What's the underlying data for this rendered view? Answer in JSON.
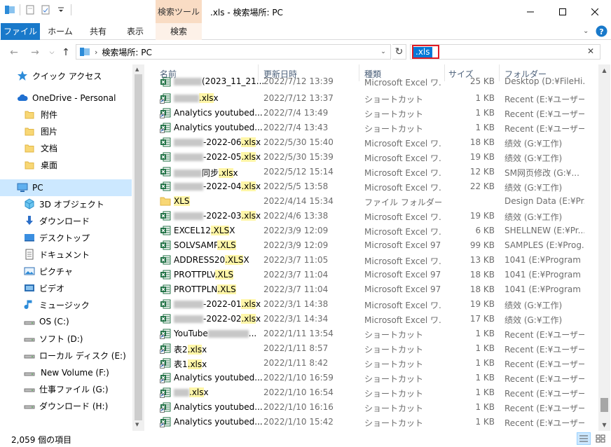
{
  "window": {
    "title": ".xls - 検索場所: PC",
    "context_tab_head": "検索ツール",
    "controls": [
      "minimize",
      "maximize",
      "close"
    ]
  },
  "ribbon": {
    "tabs": [
      "ファイル",
      "ホーム",
      "共有",
      "表示",
      "検索"
    ]
  },
  "address": {
    "crumb": "検索場所: PC"
  },
  "search": {
    "value": ".xls"
  },
  "nav": {
    "items": [
      {
        "label": "クイック アクセス",
        "icon": "star-icon"
      },
      {
        "label": "OneDrive - Personal",
        "icon": "cloud-icon"
      },
      {
        "label": "附件",
        "icon": "folder-icon"
      },
      {
        "label": "图片",
        "icon": "folder-icon"
      },
      {
        "label": "文档",
        "icon": "folder-icon"
      },
      {
        "label": "桌面",
        "icon": "folder-icon"
      },
      {
        "label": "PC",
        "icon": "pc-icon",
        "selected": true
      },
      {
        "label": "3D オブジェクト",
        "icon": "cube-icon"
      },
      {
        "label": "ダウンロード",
        "icon": "download-icon"
      },
      {
        "label": "デスクトップ",
        "icon": "desktop-icon"
      },
      {
        "label": "ドキュメント",
        "icon": "document-icon"
      },
      {
        "label": "ピクチャ",
        "icon": "picture-icon"
      },
      {
        "label": "ビデオ",
        "icon": "video-icon"
      },
      {
        "label": "ミュージック",
        "icon": "music-icon"
      },
      {
        "label": "OS (C:)",
        "icon": "drive-icon"
      },
      {
        "label": "ソフト (D:)",
        "icon": "drive-icon"
      },
      {
        "label": "ローカル ディスク (E:)",
        "icon": "drive-icon"
      },
      {
        "label": "New Volume (F:)",
        "icon": "drive-icon"
      },
      {
        "label": "仕事ファイル (G:)",
        "icon": "drive-icon"
      },
      {
        "label": "ダウンロード (H:)",
        "icon": "drive-icon"
      }
    ]
  },
  "columns": {
    "name": "名前",
    "date": "更新日時",
    "type": "種類",
    "size": "サイズ",
    "folder": "フォルダー"
  },
  "rows": [
    {
      "pre": "(2023_11_21...",
      "hl": "",
      "post": "",
      "date": "2022/7/12 13:39",
      "type": "Microsoft Excel ワ...",
      "size": "25 KB",
      "folder": "Desktop (D:¥FileHi...",
      "icon": "excel",
      "blur": 40,
      "partial": true
    },
    {
      "pre": "",
      "hl": ".xls",
      "post": "x",
      "date": "2022/7/12 13:37",
      "type": "ショートカット",
      "size": "1 KB",
      "folder": "Recent (E:¥ユーザー...",
      "icon": "excel-shortcut",
      "blur": 36
    },
    {
      "pre": "Analytics youtubed...",
      "hl": "",
      "post": "",
      "date": "2022/7/4 13:49",
      "type": "ショートカット",
      "size": "1 KB",
      "folder": "Recent (E:¥ユーザー...",
      "icon": "excel-shortcut"
    },
    {
      "pre": "Analytics youtubed...",
      "hl": "",
      "post": "",
      "date": "2022/7/4 13:43",
      "type": "ショートカット",
      "size": "1 KB",
      "folder": "Recent (E:¥ユーザー...",
      "icon": "excel-shortcut"
    },
    {
      "pre": "-2022-06",
      "hl": ".xls",
      "post": "x",
      "date": "2022/5/30 15:40",
      "type": "Microsoft Excel ワ...",
      "size": "18 KB",
      "folder": "绩效 (G:¥工作)",
      "icon": "excel",
      "blur": 42
    },
    {
      "pre": "-2022-05",
      "hl": ".xls",
      "post": "x",
      "date": "2022/5/30 15:39",
      "type": "Microsoft Excel ワ...",
      "size": "19 KB",
      "folder": "绩效 (G:¥工作)",
      "icon": "excel",
      "blur": 42
    },
    {
      "pre": "同步",
      "hl": ".xls",
      "post": "x",
      "date": "2022/5/12 15:14",
      "type": "Microsoft Excel ワ...",
      "size": "12 KB",
      "folder": "SM网页修改 (G:¥...",
      "icon": "excel",
      "blur": 40
    },
    {
      "pre": "-2022-04",
      "hl": ".xls",
      "post": "x",
      "date": "2022/5/5 13:58",
      "type": "Microsoft Excel ワ...",
      "size": "22 KB",
      "folder": "绩效 (G:¥工作)",
      "icon": "excel",
      "blur": 42
    },
    {
      "pre": "",
      "hl": "XLS",
      "post": "",
      "date": "2022/4/14 15:34",
      "type": "ファイル フォルダー",
      "size": "",
      "folder": "Design Data (E:¥Pr...",
      "icon": "folder"
    },
    {
      "pre": "-2022-03",
      "hl": ".xls",
      "post": "x",
      "date": "2022/4/6 13:38",
      "type": "Microsoft Excel ワ...",
      "size": "19 KB",
      "folder": "绩效 (G:¥工作)",
      "icon": "excel",
      "blur": 42
    },
    {
      "pre": "EXCEL12",
      "hl": ".XLS",
      "post": "X",
      "date": "2022/3/9 12:09",
      "type": "Microsoft Excel ワ...",
      "size": "6 KB",
      "folder": "SHELLNEW (E:¥Pr...",
      "icon": "excel"
    },
    {
      "pre": "SOLVSAMP",
      "hl": ".XLS",
      "post": "",
      "date": "2022/3/9 12:09",
      "type": "Microsoft Excel 97...",
      "size": "99 KB",
      "folder": "SAMPLES (E:¥Prog...",
      "icon": "excel"
    },
    {
      "pre": "ADDRESS20",
      "hl": ".XLS",
      "post": "X",
      "date": "2022/3/7 11:05",
      "type": "Microsoft Excel ワ...",
      "size": "13 KB",
      "folder": "1041 (E:¥Program ...",
      "icon": "excel"
    },
    {
      "pre": "PROTTPLV",
      "hl": ".XLS",
      "post": "",
      "date": "2022/3/7 11:04",
      "type": "Microsoft Excel 97...",
      "size": "18 KB",
      "folder": "1041 (E:¥Program ...",
      "icon": "excel"
    },
    {
      "pre": "PROTTPLN",
      "hl": ".XLS",
      "post": "",
      "date": "2022/3/7 11:04",
      "type": "Microsoft Excel 97...",
      "size": "18 KB",
      "folder": "1041 (E:¥Program ...",
      "icon": "excel"
    },
    {
      "pre": "-2022-01",
      "hl": ".xls",
      "post": "x",
      "date": "2022/3/1 14:38",
      "type": "Microsoft Excel ワ...",
      "size": "19 KB",
      "folder": "绩效 (G:¥工作)",
      "icon": "excel",
      "blur": 42
    },
    {
      "pre": "-2022-02",
      "hl": ".xls",
      "post": "x",
      "date": "2022/3/1 14:34",
      "type": "Microsoft Excel ワ...",
      "size": "17 KB",
      "folder": "绩效 (G:¥工作)",
      "icon": "excel",
      "blur": 42
    },
    {
      "pre": "YouTube",
      "hl": "",
      "post": "...",
      "date": "2022/1/11 13:54",
      "type": "ショートカット",
      "size": "1 KB",
      "folder": "Recent (E:¥ユーザー...",
      "icon": "excel-shortcut",
      "blurAfter": 58
    },
    {
      "pre": "表2",
      "hl": ".xls",
      "post": "x",
      "date": "2022/1/11 8:57",
      "type": "ショートカット",
      "size": "1 KB",
      "folder": "Recent (E:¥ユーザー...",
      "icon": "excel-shortcut"
    },
    {
      "pre": "表1",
      "hl": ".xls",
      "post": "x",
      "date": "2022/1/11 8:42",
      "type": "ショートカット",
      "size": "1 KB",
      "folder": "Recent (E:¥ユーザー...",
      "icon": "excel-shortcut"
    },
    {
      "pre": "Analytics youtubed...",
      "hl": "",
      "post": "",
      "date": "2022/1/10 16:59",
      "type": "ショートカット",
      "size": "1 KB",
      "folder": "Recent (E:¥ユーザー...",
      "icon": "excel-shortcut"
    },
    {
      "pre": "",
      "hl": ".xls",
      "post": "x",
      "date": "2022/1/10 16:54",
      "type": "ショートカット",
      "size": "1 KB",
      "folder": "Recent (E:¥ユーザー...",
      "icon": "excel-shortcut",
      "blur": 22
    },
    {
      "pre": "Analytics youtubed...",
      "hl": "",
      "post": "",
      "date": "2022/1/10 16:16",
      "type": "ショートカット",
      "size": "1 KB",
      "folder": "Recent (E:¥ユーザー...",
      "icon": "excel-shortcut"
    },
    {
      "pre": "Analytics youtubed...",
      "hl": "",
      "post": "",
      "date": "2022/1/10 15:42",
      "type": "ショートカット",
      "size": "1 KB",
      "folder": "Recent (E:¥ユーザー...",
      "icon": "excel-shortcut"
    }
  ],
  "status": {
    "count": "2,059 個の項目"
  },
  "colors": {
    "file_tab": "#1979ca",
    "selection": "#cce8ff",
    "highlight": "#fff6a8",
    "search_outline": "#e01b24",
    "excel_green": "#1d6f42"
  }
}
